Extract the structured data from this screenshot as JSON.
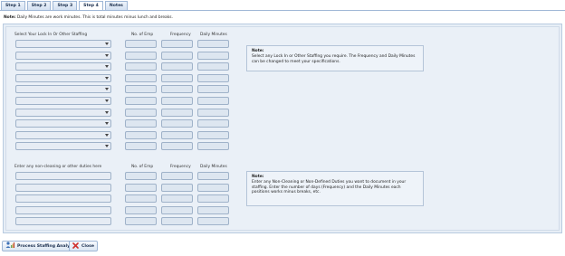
{
  "tabs": [
    {
      "label": "Step 1"
    },
    {
      "label": "Step 2"
    },
    {
      "label": "Step 3"
    },
    {
      "label": "Step 4"
    },
    {
      "label": "Notes"
    }
  ],
  "top_note": {
    "prefix": "Note:",
    "text": " Daily Minutes are work minutes. This is total minutes minus lunch and breaks."
  },
  "lockin": {
    "headers": {
      "select": "Select Your Lock In Or Other Staffing",
      "emp": "No. of Emp",
      "freq": "Frequency",
      "daily": "Daily Minutes"
    },
    "rows": 10,
    "note_title": "Note:",
    "note_text": "Select any Lock In or Other Staffing you require. The Frequency and Daily Minutes can be changed to meet your specifications."
  },
  "noncleaning": {
    "headers": {
      "duties": "Enter any non-cleaning or other duties here",
      "emp": "No. of Emp",
      "freq": "Frequency",
      "daily": "Daily Minutes"
    },
    "rows": 5,
    "note_title": "Note:",
    "note_text": "Enter any Non-Cleaning or Non-Defined Duties you want to document in your staffing. Enter the number of days (Frequency) and the Daily Minutes each positions works minus breaks, etc."
  },
  "buttons": {
    "process": "Process Staffing Analysis",
    "close": "Close"
  },
  "icons": {
    "process": "people-chart-icon",
    "close": "red-x-icon"
  },
  "colors": {
    "panel_bg": "#e7eef6",
    "field_border": "#9fb2c9",
    "tab_border": "#9fb7d6",
    "close_red": "#d0312d"
  }
}
